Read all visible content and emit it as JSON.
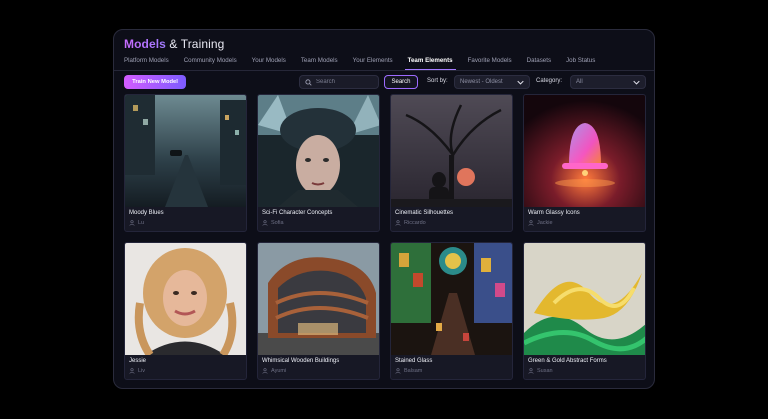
{
  "header": {
    "title_accent": "Models",
    "title_rest": " & Training"
  },
  "tabs": [
    {
      "label": "Platform Models"
    },
    {
      "label": "Community Models"
    },
    {
      "label": "Your Models"
    },
    {
      "label": "Team Models"
    },
    {
      "label": "Your Elements"
    },
    {
      "label": "Team Elements",
      "active": true
    },
    {
      "label": "Favorite Models"
    },
    {
      "label": "Datasets"
    },
    {
      "label": "Job Status"
    }
  ],
  "toolbar": {
    "train_label": "Train New Model",
    "search_placeholder": "Search",
    "search_button": "Search",
    "sort_label": "Sort by:",
    "sort_value": "Newest - Oldest",
    "category_label": "Category:",
    "category_value": "All"
  },
  "cards": [
    {
      "name": "Moody Blues",
      "author": "Lu"
    },
    {
      "name": "Sci-Fi Character Concepts",
      "author": "Sofia"
    },
    {
      "name": "Cinematic Silhouettes",
      "author": "Riccardo"
    },
    {
      "name": "Warm Glassy Icons",
      "author": "Jackie"
    },
    {
      "name": "Jessie",
      "author": "Liv"
    },
    {
      "name": "Whimsical Wooden Buildings",
      "author": "Ayumi"
    },
    {
      "name": "Stained Glass",
      "author": "Balsam"
    },
    {
      "name": "Green & Gold Abstract Forms",
      "author": "Susan"
    }
  ],
  "colors": {
    "accent": "#a47bff",
    "background": "#0d0e18"
  },
  "icons": {
    "search": "search-icon",
    "chevron": "chevron-down-icon",
    "user": "user-icon"
  }
}
